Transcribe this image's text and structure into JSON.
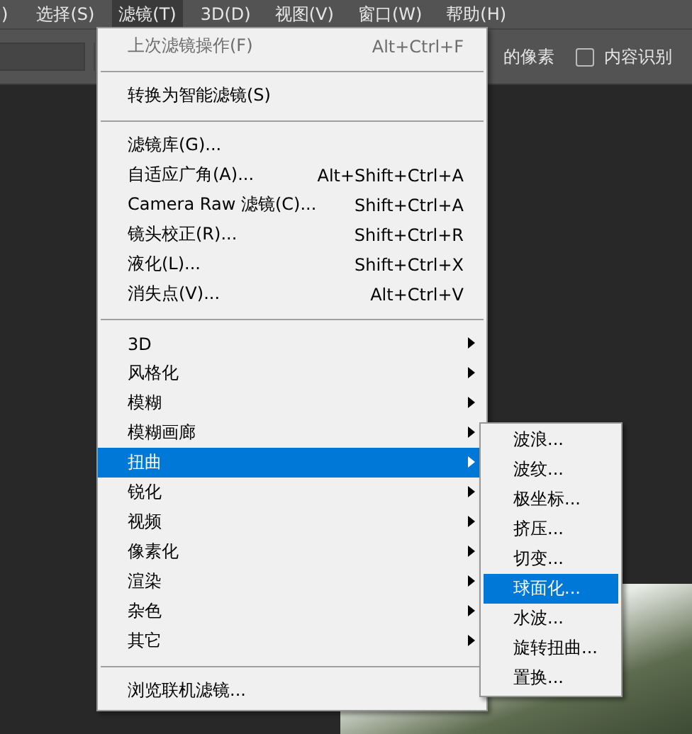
{
  "menu_bar": [
    {
      "label": ")",
      "selected": false
    },
    {
      "label": "选择(S)",
      "selected": false
    },
    {
      "label": "滤镜(T)",
      "selected": true
    },
    {
      "label": "3D(D)",
      "selected": false
    },
    {
      "label": "视图(V)",
      "selected": false
    },
    {
      "label": "窗口(W)",
      "selected": false
    },
    {
      "label": "帮助(H)",
      "selected": false
    }
  ],
  "options_bar": {
    "text": "的像素",
    "checkbox": {
      "label": "内容识别",
      "checked": false
    }
  },
  "menu": [
    {
      "kind": "item",
      "label": "上次滤镜操作(F)",
      "shortcut": "Alt+Ctrl+F",
      "disabled": true,
      "submenu": false,
      "selected": false
    },
    {
      "kind": "separator"
    },
    {
      "kind": "item",
      "label": "转换为智能滤镜(S)",
      "disabled": false,
      "submenu": false,
      "selected": false
    },
    {
      "kind": "separator"
    },
    {
      "kind": "item",
      "label": "滤镜库(G)...",
      "disabled": false,
      "submenu": false,
      "selected": false
    },
    {
      "kind": "item",
      "label": "自适应广角(A)...",
      "shortcut": "Alt+Shift+Ctrl+A",
      "disabled": false,
      "submenu": false,
      "selected": false
    },
    {
      "kind": "item",
      "label": "Camera Raw 滤镜(C)...",
      "shortcut": "Shift+Ctrl+A",
      "disabled": false,
      "submenu": false,
      "selected": false
    },
    {
      "kind": "item",
      "label": "镜头校正(R)...",
      "shortcut": "Shift+Ctrl+R",
      "disabled": false,
      "submenu": false,
      "selected": false
    },
    {
      "kind": "item",
      "label": "液化(L)...",
      "shortcut": "Shift+Ctrl+X",
      "disabled": false,
      "submenu": false,
      "selected": false
    },
    {
      "kind": "item",
      "label": "消失点(V)...",
      "shortcut": "Alt+Ctrl+V",
      "disabled": false,
      "submenu": false,
      "selected": false
    },
    {
      "kind": "separator"
    },
    {
      "kind": "item",
      "label": "3D",
      "disabled": false,
      "submenu": true,
      "selected": false
    },
    {
      "kind": "item",
      "label": "风格化",
      "disabled": false,
      "submenu": true,
      "selected": false
    },
    {
      "kind": "item",
      "label": "模糊",
      "disabled": false,
      "submenu": true,
      "selected": false
    },
    {
      "kind": "item",
      "label": "模糊画廊",
      "disabled": false,
      "submenu": true,
      "selected": false
    },
    {
      "kind": "item",
      "label": "扭曲",
      "disabled": false,
      "submenu": true,
      "selected": true
    },
    {
      "kind": "item",
      "label": "锐化",
      "disabled": false,
      "submenu": true,
      "selected": false
    },
    {
      "kind": "item",
      "label": "视频",
      "disabled": false,
      "submenu": true,
      "selected": false
    },
    {
      "kind": "item",
      "label": "像素化",
      "disabled": false,
      "submenu": true,
      "selected": false
    },
    {
      "kind": "item",
      "label": "渲染",
      "disabled": false,
      "submenu": true,
      "selected": false
    },
    {
      "kind": "item",
      "label": "杂色",
      "disabled": false,
      "submenu": true,
      "selected": false
    },
    {
      "kind": "item",
      "label": "其它",
      "disabled": false,
      "submenu": true,
      "selected": false
    },
    {
      "kind": "separator"
    },
    {
      "kind": "item",
      "label": "浏览联机滤镜...",
      "disabled": false,
      "submenu": false,
      "selected": false
    }
  ],
  "submenu": [
    {
      "label": "波浪...",
      "selected": false
    },
    {
      "label": "波纹...",
      "selected": false
    },
    {
      "label": "极坐标...",
      "selected": false
    },
    {
      "label": "挤压...",
      "selected": false
    },
    {
      "label": "切变...",
      "selected": false
    },
    {
      "label": "球面化...",
      "selected": true
    },
    {
      "label": "水波...",
      "selected": false
    },
    {
      "label": "旋转扭曲...",
      "selected": false
    },
    {
      "label": "置换...",
      "selected": false
    }
  ]
}
